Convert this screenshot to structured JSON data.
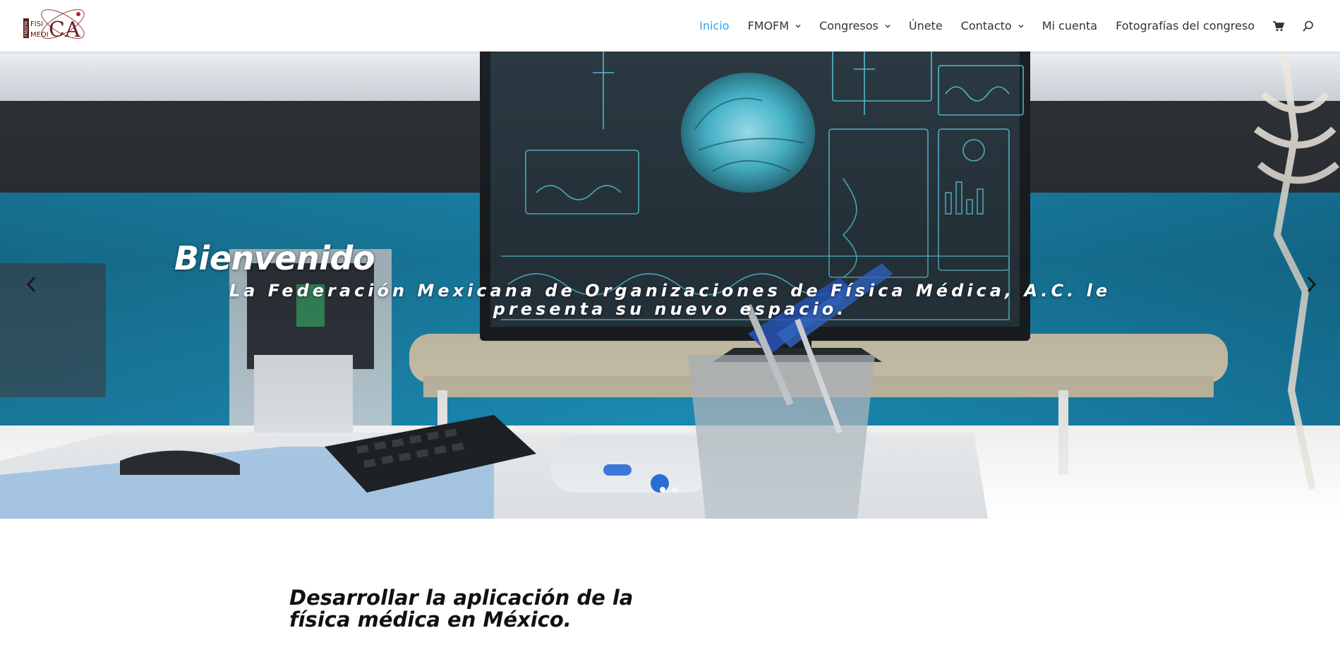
{
  "header": {
    "logo": {
      "text_top": "FISI",
      "text_bottom": "MEDI",
      "text_big": "CA",
      "text_side": "FMOFM"
    },
    "nav": [
      {
        "label": "Inicio",
        "active": true,
        "has_dropdown": false
      },
      {
        "label": "FMOFM",
        "active": false,
        "has_dropdown": true
      },
      {
        "label": "Congresos",
        "active": false,
        "has_dropdown": true
      },
      {
        "label": "Únete",
        "active": false,
        "has_dropdown": false
      },
      {
        "label": "Contacto",
        "active": false,
        "has_dropdown": true
      },
      {
        "label": "Mi cuenta",
        "active": false,
        "has_dropdown": false
      },
      {
        "label": "Fotografías del congreso",
        "active": false,
        "has_dropdown": false
      }
    ],
    "icons": {
      "cart": "shopping-cart-icon",
      "search": "search-icon"
    }
  },
  "hero": {
    "title": "Bienvenido",
    "subtitle": "La Federación Mexicana de Organizaciones de Física Médica, A.C. le presenta su nuevo espacio.",
    "slide_count": 2,
    "active_slide": 1
  },
  "content": {
    "mission": "Desarrollar la aplicación de la física médica en México."
  },
  "colors": {
    "accent": "#2ea3f2",
    "nav_text": "#333333",
    "hero_wall_blue": "#1f8fb5",
    "hero_dark_band": "#2e3338",
    "screen": "#2a3a45",
    "screen_glow": "#5fd4e6"
  }
}
